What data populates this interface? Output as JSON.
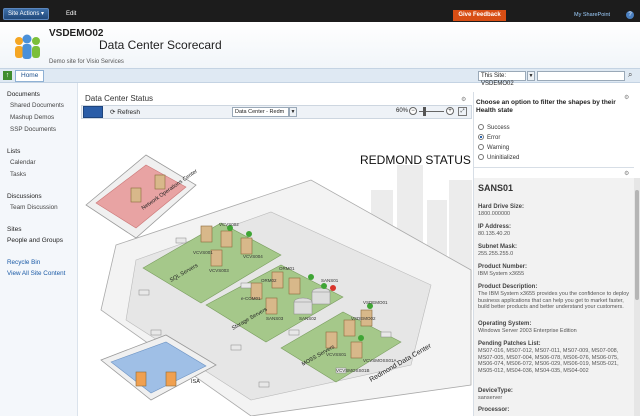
{
  "topbar": {
    "site_actions": "Site Actions",
    "edit": "Edit",
    "give_feedback": "Give Feedback",
    "user": "My SharePoint"
  },
  "header": {
    "site_name": "VSDEMO02",
    "page_title": "Data Center Scorecard",
    "subtitle": "Demo site for Visio Services"
  },
  "navbar": {
    "home": "Home",
    "search_scope_label": "This Site:",
    "search_scope_value": "This Site: VSDEMO02"
  },
  "leftnav": {
    "documents": "Documents",
    "doc_items": [
      "Shared Documents",
      "Mashup Demos",
      "SSP Documents"
    ],
    "lists": "Lists",
    "list_items": [
      "Calendar",
      "Tasks"
    ],
    "discussions": "Discussions",
    "discussion_items": [
      "Team Discussion"
    ],
    "sites": "Sites",
    "people": "People and Groups",
    "recycle_bin": "Recycle Bin",
    "view_all": "View All Site Content"
  },
  "webpart": {
    "title": "Data Center Status",
    "refresh": "Refresh",
    "page_select": "Data Center - Redm",
    "zoom": "60%"
  },
  "diagram": {
    "status_title": "REDMOND STATUS",
    "labels": {
      "noc": "Network Operations Center",
      "sql": "SQL Servers",
      "storage": "Storage Servers",
      "moss": "MOSS Servers",
      "redmond": "Redmond Data Center",
      "isa": "ISA"
    },
    "servers": [
      "VCVS001",
      "VCVS002",
      "VCVS003",
      "VCVS004",
      "ORM01",
      "ORM02",
      "e-COM01",
      "SANS01",
      "SANS02",
      "SANS03",
      "VCVSS01",
      "VSDEMO01",
      "VSDEMO02",
      "VCVSMOSS01A",
      "VCVSMOSS01B"
    ]
  },
  "filter": {
    "prompt": "Choose an option to filter the shapes by their Health state",
    "options": [
      "Success",
      "Error",
      "Warning",
      "Uninitialized"
    ],
    "selected": "Error"
  },
  "detail": {
    "title": "SANS01",
    "fields": [
      {
        "label": "Hard Drive Size:",
        "value": "1800.000000"
      },
      {
        "label": "IP Address:",
        "value": "80.135.40.20"
      },
      {
        "label": "Subnet Mask:",
        "value": "255.255.255.0"
      },
      {
        "label": "Product Number:",
        "value": "IBM System x3655"
      },
      {
        "label": "Product Description:",
        "value": "The IBM System x3655 provides you the confidence to deploy business applications that can help you get to market faster, build better products and better understand your customers."
      },
      {
        "label": "Operating System:",
        "value": "Windows Server 2003 Enterprise Edition"
      },
      {
        "label": "Pending Patches List:",
        "value": "MS07-016, MS07-012, MS07-011, MS07-009, MS07-008, MS07-005, MS07-004, MS06-078, MS06-076, MS06-075, MS06-074, MS06-072, MS06-029, MS06-019, MS05-021, MS05-012, MS04-036, MS04-035, MS04-002"
      },
      {
        "label": "DeviceType:",
        "value": "sanserver"
      },
      {
        "label": "Processor:",
        "value": ""
      }
    ]
  },
  "colors": {
    "accent": "#2a5da8",
    "feedback": "#d84e14",
    "sql_zone": "#a5c88a",
    "noc_zone": "#e8a3a3",
    "isa_zone": "#9fbfe6"
  }
}
